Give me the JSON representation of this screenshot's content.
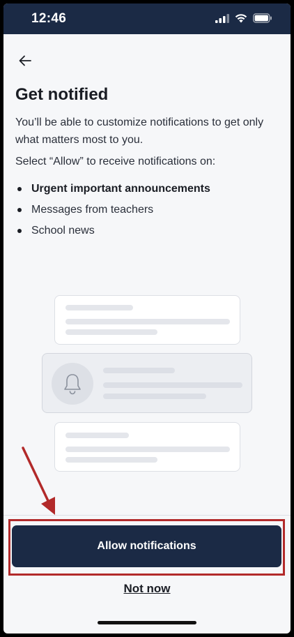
{
  "status_bar": {
    "time": "12:46",
    "icons": [
      "signal-icon",
      "wifi-icon",
      "battery-icon"
    ]
  },
  "nav": {
    "back_icon": "arrow-left-icon"
  },
  "content": {
    "title": "Get notified",
    "description": "You’ll be able to customize notifications to get only what matters most to you.",
    "select_text": "Select “Allow” to receive notifications on:",
    "bullets": [
      "Urgent important announcements",
      "Messages from teachers",
      "School news"
    ]
  },
  "illustration": {
    "icon": "bell-icon"
  },
  "actions": {
    "allow_label": "Allow notifications",
    "not_now_label": "Not now"
  },
  "colors": {
    "primary": "#1b2a45",
    "background": "#f6f7f9",
    "annotation": "#b22a2a"
  }
}
